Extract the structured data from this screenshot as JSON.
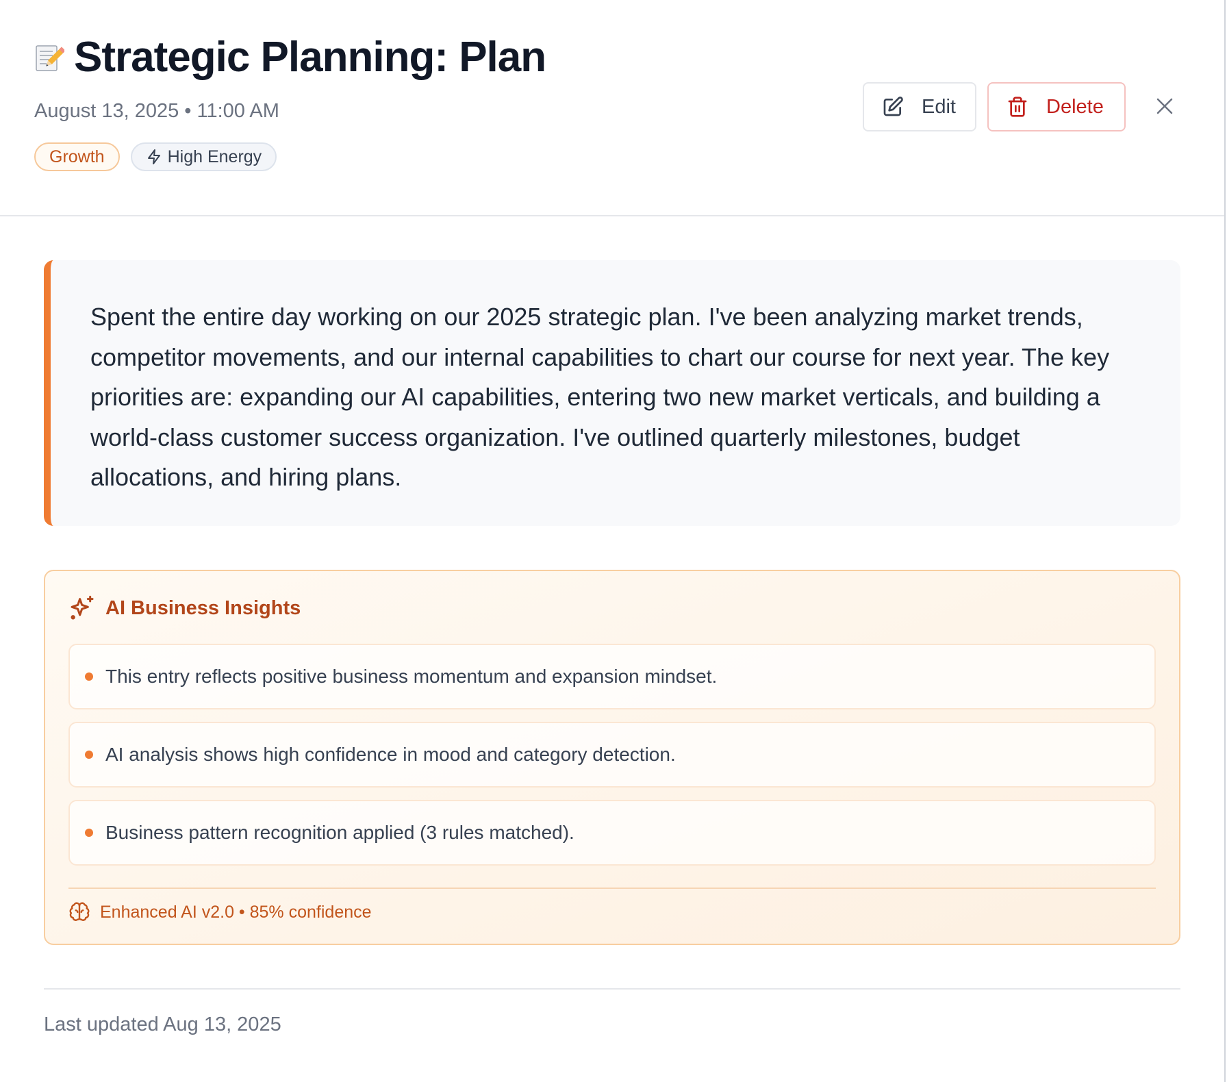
{
  "header": {
    "title": "Strategic Planning: Plan",
    "title_icon": "memo-icon",
    "datetime": "August 13, 2025 • 11:00 AM",
    "tags": [
      {
        "label": "Growth",
        "color": "#c2551c"
      },
      {
        "label": "High Energy",
        "icon": "lightning-icon",
        "color": "#374151"
      }
    ],
    "actions": {
      "edit_label": "Edit",
      "edit_icon": "edit-icon",
      "delete_label": "Delete",
      "delete_icon": "trash-icon",
      "close_icon": "close-icon"
    }
  },
  "entry": {
    "content": "Spent the entire day working on our 2025 strategic plan. I've been analyzing market trends, competitor movements, and our internal capabilities to chart our course for next year. The key priorities are: expanding our AI capabilities, entering two new market verticals, and building a world-class customer success organization. I've outlined quarterly milestones, budget allocations, and hiring plans.",
    "accent_color": "#ef7b32"
  },
  "insights": {
    "title": "AI Business Insights",
    "title_icon": "sparkles-icon",
    "items": [
      "This entry reflects positive business momentum and expansion mindset.",
      "AI analysis shows high confidence in mood and category detection.",
      "Business pattern recognition applied (3 rules matched)."
    ],
    "footer": "Enhanced AI v2.0 • 85% confidence",
    "footer_icon": "brain-icon"
  },
  "footer": {
    "updated": "Last updated Aug 13, 2025"
  }
}
